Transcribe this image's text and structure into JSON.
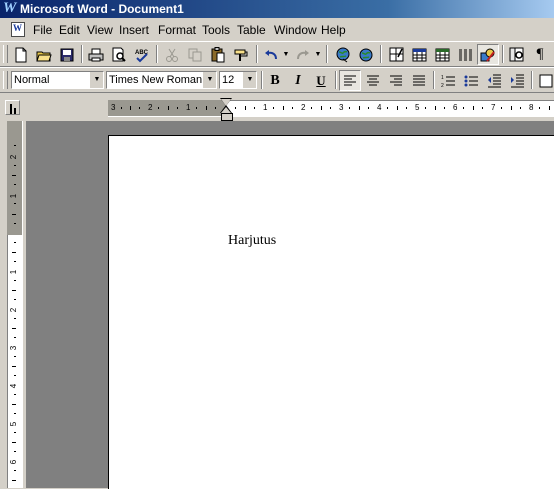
{
  "window": {
    "title": "Microsoft Word - Document1"
  },
  "menubar": {
    "items": [
      {
        "label": "File"
      },
      {
        "label": "Edit"
      },
      {
        "label": "View"
      },
      {
        "label": "Insert"
      },
      {
        "label": "Format"
      },
      {
        "label": "Tools"
      },
      {
        "label": "Table"
      },
      {
        "label": "Window"
      },
      {
        "label": "Help"
      }
    ]
  },
  "formatting": {
    "style": "Normal",
    "font": "Times New Roman",
    "size": "12",
    "bold": "B",
    "italic": "I",
    "underline": "U"
  },
  "ruler": {
    "h_labels": [
      "3",
      "2",
      "1",
      "1",
      "2",
      "3",
      "4",
      "5",
      "6",
      "7",
      "8"
    ],
    "v_labels": [
      "2",
      "1",
      "1",
      "2",
      "3",
      "4",
      "5",
      "6"
    ]
  },
  "document": {
    "text": "Harjutus"
  },
  "colors": {
    "titlebar_start": "#0a246a",
    "titlebar_end": "#a6caf0",
    "chrome": "#d4d0c8",
    "workspace": "#808080"
  }
}
